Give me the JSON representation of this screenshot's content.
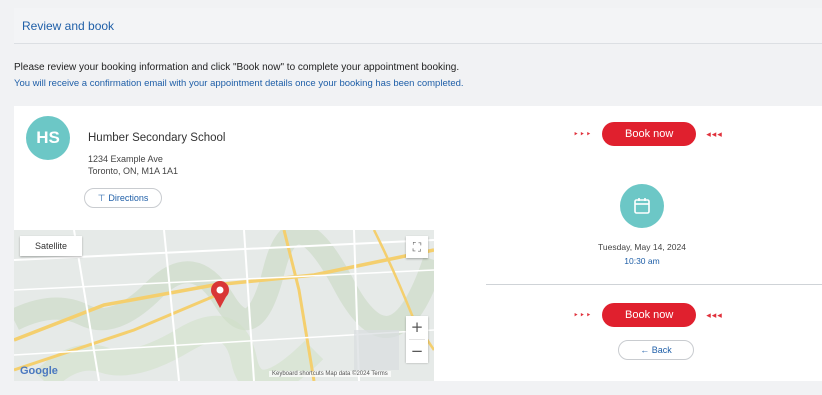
{
  "header": {
    "title": "Review and book"
  },
  "intro": {
    "line1": "Please review your booking information and click \"Book now\" to complete your appointment booking.",
    "line2": "You will receive a confirmation email with your appointment details once your booking has been completed."
  },
  "location": {
    "initials": "HS",
    "name": "Humber Secondary School",
    "address_line1": "1234 Example Ave",
    "address_line2": "Toronto, ON, M1A 1A1",
    "directions_label": "Directions"
  },
  "map": {
    "satellite_label": "Satellite",
    "zoom_in": "+",
    "zoom_out": "−",
    "fullscreen": "⛶",
    "google_logo": "Google",
    "attribution": "Keyboard shortcuts  Map data ©2024  Terms"
  },
  "booking": {
    "book_now_label": "Book now",
    "arrows_left": "‣‣‣",
    "arrows_right": "◂◂◂",
    "date": "Tuesday, May 14, 2024",
    "time": "10:30 am",
    "back_label": "← Back"
  },
  "colors": {
    "accent": "#6cc7c6",
    "book_red": "#e0202e",
    "link_blue": "#1f5fa8"
  }
}
